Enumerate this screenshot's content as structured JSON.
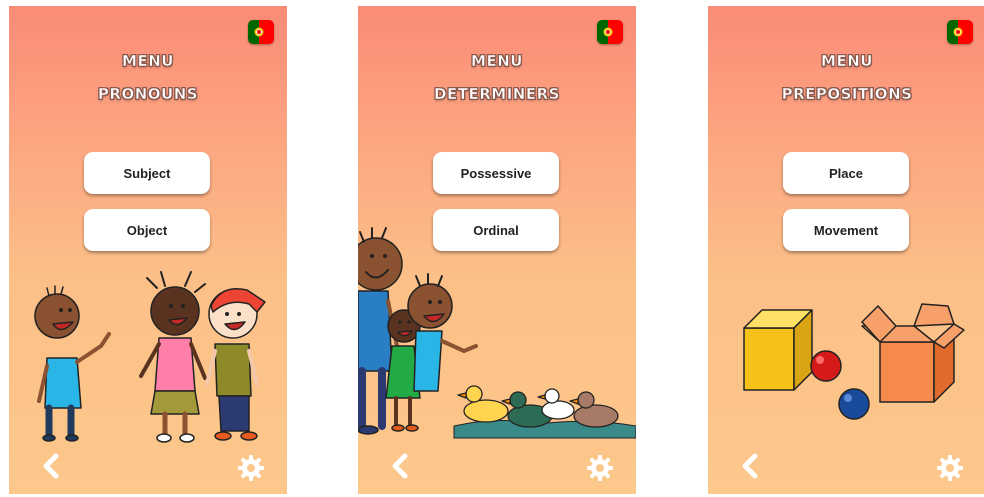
{
  "colors": {
    "background_top": "#fb8b76",
    "background_bottom": "#fcc88b",
    "button_bg": "#ffffff",
    "title_text": "#ffffff",
    "title_outline": "#8a5a4f",
    "flag_green": "#006600",
    "flag_red": "#ff0000"
  },
  "screens": [
    {
      "name": "pronouns",
      "title_line1": "MENU",
      "title_line2": "PRONOUNS",
      "buttons": [
        {
          "label": "Subject"
        },
        {
          "label": "Object"
        }
      ],
      "illustration": "three-children-icon",
      "flag_icon": "portugal-flag-icon",
      "back_icon": "chevron-left-icon",
      "settings_icon": "gear-icon"
    },
    {
      "name": "determiners",
      "title_line1": "MENU",
      "title_line2": "DETERMINERS",
      "buttons": [
        {
          "label": "Possessive"
        },
        {
          "label": "Ordinal"
        }
      ],
      "illustration": "children-and-ducks-icon",
      "flag_icon": "portugal-flag-icon",
      "back_icon": "chevron-left-icon",
      "settings_icon": "gear-icon"
    },
    {
      "name": "prepositions",
      "title_line1": "MENU",
      "title_line2": "PREPOSITIONS",
      "buttons": [
        {
          "label": "Place"
        },
        {
          "label": "Movement"
        }
      ],
      "illustration": "boxes-and-balls-icon",
      "flag_icon": "portugal-flag-icon",
      "back_icon": "chevron-left-icon",
      "settings_icon": "gear-icon"
    }
  ]
}
